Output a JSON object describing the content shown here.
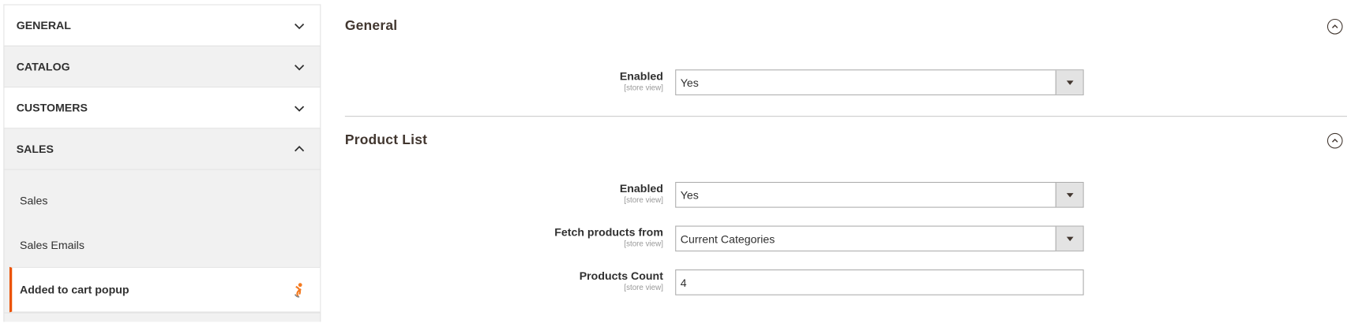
{
  "sidebar": {
    "sections": [
      {
        "label": "GENERAL",
        "state": "collapsed"
      },
      {
        "label": "CATALOG",
        "state": "collapsed"
      },
      {
        "label": "CUSTOMERS",
        "state": "collapsed"
      },
      {
        "label": "SALES",
        "state": "expanded"
      }
    ],
    "sales_items": [
      {
        "label": "Sales"
      },
      {
        "label": "Sales Emails"
      },
      {
        "label": "Added to cart popup",
        "active": true,
        "icon": "vendor-logo-icon"
      }
    ],
    "accent_color": "#eb5202"
  },
  "main": {
    "general": {
      "title": "General",
      "fields": [
        {
          "label": "Enabled",
          "scope": "[store view]",
          "value": "Yes",
          "type": "select"
        }
      ]
    },
    "product_list": {
      "title": "Product List",
      "fields": [
        {
          "label": "Enabled",
          "scope": "[store view]",
          "value": "Yes",
          "type": "select"
        },
        {
          "label": "Fetch products from",
          "scope": "[store view]",
          "value": "Current Categories",
          "type": "select"
        },
        {
          "label": "Products Count",
          "scope": "[store view]",
          "value": "4",
          "type": "text"
        }
      ]
    }
  }
}
